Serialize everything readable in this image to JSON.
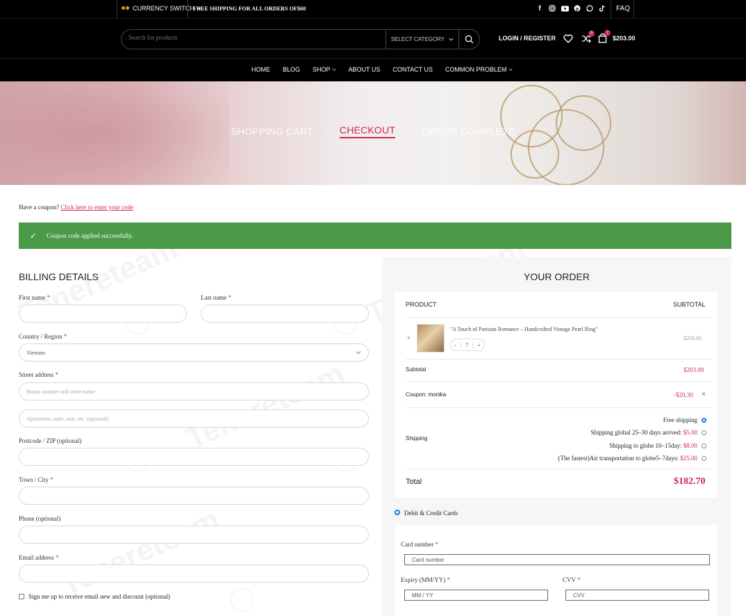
{
  "topbar": {
    "currency_label": "CURRENCY SWITCH",
    "shipping_notice": "FREE SHIPPING FOR ALL ORDERS OF$60",
    "social_icons": [
      "facebook-icon",
      "instagram-icon",
      "youtube-icon",
      "pinterest-icon",
      "whatsapp-icon",
      "tiktok-icon"
    ],
    "faq_label": "FAQ"
  },
  "header": {
    "search_placeholder": "Search for products",
    "category_label": "SELECT CATEGORY",
    "login_label": "LOGIN / REGISTER",
    "compare_count": "0",
    "cart_count": "7",
    "cart_total": "$203.00"
  },
  "nav": {
    "items": [
      {
        "label": "HOME",
        "dropdown": false
      },
      {
        "label": "BLOG",
        "dropdown": false
      },
      {
        "label": "SHOP",
        "dropdown": true
      },
      {
        "label": "ABOUT US",
        "dropdown": false
      },
      {
        "label": "CONTACT US",
        "dropdown": false
      },
      {
        "label": "COMMON PROBLEM",
        "dropdown": true
      }
    ]
  },
  "steps": {
    "cart": "SHOPPING CART",
    "checkout": "CHECKOUT",
    "complete": "ORDER COMPLETE",
    "arrow": "→"
  },
  "coupon": {
    "prompt": "Have a coupon?",
    "link": "Click here to enter your code",
    "success": "Coupon code applied successfully."
  },
  "billing": {
    "title": "BILLING DETAILS",
    "first_name": "First name",
    "last_name": "Last name",
    "country": "Country / Region",
    "country_value": "Vietnam",
    "street": "Street address",
    "street_ph1": "House number and street name",
    "street_ph2": "Apartment, suite, unit, etc. (optional)",
    "postcode": "Postcode / ZIP (optional)",
    "town": "Town / City",
    "phone": "Phone (optional)",
    "email": "Email address",
    "required_mark": "*",
    "signup": "Sign me up to receive email new and discount (optional)"
  },
  "order": {
    "title": "YOUR ORDER",
    "col_product": "PRODUCT",
    "col_subtotal": "SUBTOTAL",
    "remove": "×",
    "product_name": "\"A Touch of Parisian Romance – Handcrafted Vintage Pearl Ring\"",
    "qty_minus": "-",
    "qty": "7",
    "qty_plus": "+",
    "product_price": "$203.00",
    "subtotal_label": "Subtotal",
    "subtotal_value": "$203.00",
    "coupon_label": "Coupon: monika",
    "coupon_value": "-$20.30",
    "coupon_remove": "×",
    "shipping_label": "Shipping",
    "shipping_options": [
      {
        "label": "Free shipping",
        "price": "",
        "selected": true
      },
      {
        "label": "Shipping global 25–30 days arrived: ",
        "price": "$5.00",
        "selected": false
      },
      {
        "label": "Shipping to globe 10–15day: ",
        "price": "$8.00",
        "selected": false
      },
      {
        "label": "(The fastest)Air transportation to globe5–7days: ",
        "price": "$25.00",
        "selected": false
      }
    ],
    "total_label": "Total",
    "total_value": "$182.70"
  },
  "payment": {
    "method": "Debit & Credit Cards",
    "card_number_label": "Card number",
    "card_number_ph": "Card number",
    "expiry_label": "Expiry (MM/YY)",
    "expiry_ph": "MM / YY",
    "cvv_label": "CVV",
    "cvv_ph": "CVV",
    "required_mark": "*"
  },
  "colors": {
    "accent": "#d0264e",
    "success": "#4a9a47",
    "header_bg": "#000000",
    "radio": "#1a73e8"
  }
}
